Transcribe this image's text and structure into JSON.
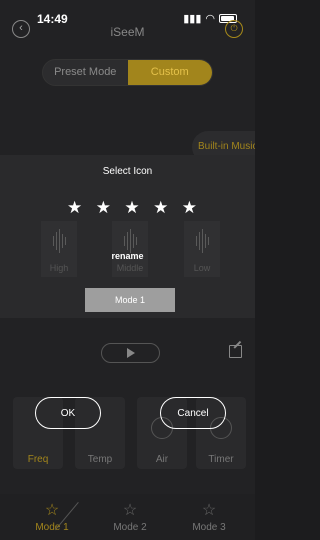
{
  "status_bar": {
    "time": "14:49"
  },
  "header": {
    "title": "iSeeM"
  },
  "mode_switch": {
    "preset_label": "Preset Mode",
    "custom_label": "Custom"
  },
  "builtin_music_label": "Built-in Music",
  "dialog": {
    "title": "Select Icon",
    "stars": [
      "★",
      "★",
      "★",
      "★",
      "★"
    ],
    "rename_label": "rename",
    "name_value": "Mode 1",
    "ok_label": "OK",
    "cancel_label": "Cancel"
  },
  "eq": {
    "high": "High",
    "middle": "Middle",
    "low": "Low"
  },
  "controls": {
    "freq": "Freq",
    "temp": "Temp",
    "air": "Air",
    "timer": "Timer"
  },
  "tabs": [
    {
      "label": "Mode 1",
      "icon": "☆"
    },
    {
      "label": "Mode 2",
      "icon": "☆"
    },
    {
      "label": "Mode 3",
      "icon": "☆"
    }
  ],
  "colors": {
    "accent": "#a2851c",
    "background": "#222224"
  }
}
